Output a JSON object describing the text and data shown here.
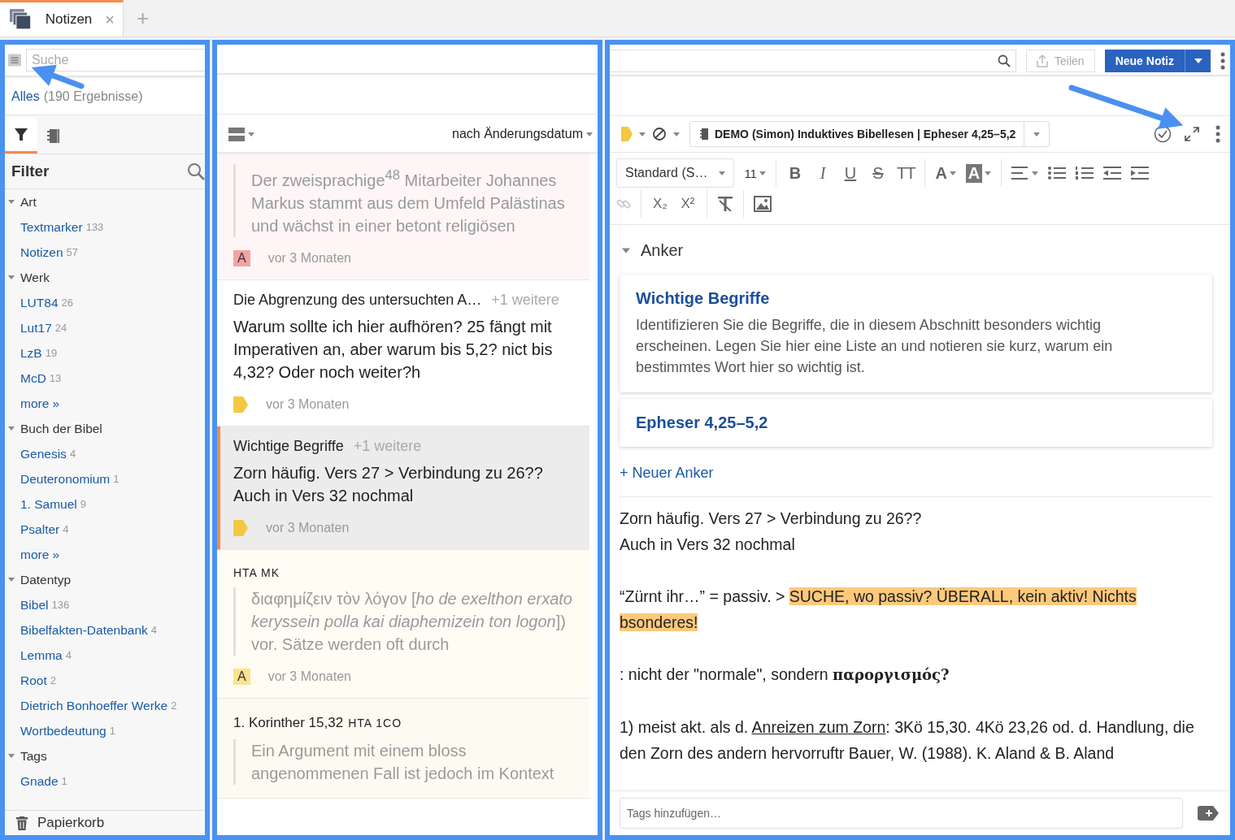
{
  "tab": {
    "title": "Notizen",
    "selected": true,
    "close": "×",
    "add": "+"
  },
  "sidebar": {
    "search": {
      "placeholder": "Suche"
    },
    "scope": {
      "label": "Alles",
      "count": "(190 Ergebnisse)"
    },
    "tabs": [
      {
        "kind": "filter",
        "selected": true
      },
      {
        "kind": "notebooks",
        "selected": false
      }
    ],
    "filter_title": "Filter",
    "groups": [
      {
        "label": "Art",
        "expanded": true,
        "items": [
          {
            "label": "Textmarker",
            "count": "133"
          },
          {
            "label": "Notizen",
            "count": "57"
          }
        ]
      },
      {
        "label": "Werk",
        "expanded": true,
        "items": [
          {
            "label": "LUT84",
            "count": "26"
          },
          {
            "label": "Lut17",
            "count": "24"
          },
          {
            "label": "LzB",
            "count": "19"
          },
          {
            "label": "McD",
            "count": "13"
          },
          {
            "label": "more »"
          }
        ]
      },
      {
        "label": "Buch der Bibel",
        "expanded": true,
        "items": [
          {
            "label": "Genesis",
            "count": "4"
          },
          {
            "label": "Deuteronomium",
            "count": "1"
          },
          {
            "label": "1. Samuel",
            "count": "9"
          },
          {
            "label": "Psalter",
            "count": "4"
          },
          {
            "label": "more »"
          }
        ]
      },
      {
        "label": "Datentyp",
        "expanded": true,
        "items": [
          {
            "label": "Bibel",
            "count": "136"
          },
          {
            "label": "Bibelfakten-Datenbank",
            "count": "4"
          },
          {
            "label": "Lemma",
            "count": "4"
          },
          {
            "label": "Root",
            "count": "2"
          },
          {
            "label": "Dietrich Bonhoeffer Werke",
            "count": "2"
          },
          {
            "label": "Wortbedeutung",
            "count": "1"
          }
        ]
      },
      {
        "label": "Tags",
        "expanded": true,
        "items": [
          {
            "label": "Gnade",
            "count": "1"
          }
        ]
      }
    ],
    "trash": "Papierkorb"
  },
  "list": {
    "sort": "nach Änderungsdatum",
    "cards": [
      {
        "kind": "highlight",
        "selected": false,
        "color": "#f4a3a3",
        "quote": "Der zweisprachige$^{48}$ Mitarbeiter Johannes Markus stammt aus dem Umfeld Palästinas und wächst in einer betont religiösen",
        "badge": "A",
        "time": "vor 3 Monaten"
      },
      {
        "kind": "note",
        "selected": false,
        "title": "Die Abgrenzung des untersuchten A…",
        "more": "+1 weitere",
        "body": "Warum sollte ich hier aufhören? 25 fängt mit Imperativen an, aber warum bis 5,2? nict bis 4,32? Oder noch weiter?h",
        "time": "vor 3 Monaten"
      },
      {
        "kind": "note",
        "selected": true,
        "title": "Wichtige Begriffe",
        "more": "+1 weitere",
        "body": "Zorn häufig. Vers 27 > Verbindung zu 26??\nAuch in Vers 32 nochmal",
        "time": "vor 3 Monaten"
      },
      {
        "kind": "highlight",
        "selected": false,
        "color": "#fbe38e",
        "heading": "HTA MK",
        "quote": "διαφημίζειν τὸν λόγον [*ho de exelthon erxato keryssein polla kai diaphemizein ton logon*]) vor. Sätze werden oft durch",
        "badge": "A",
        "time": "vor 3 Monaten"
      },
      {
        "kind": "highlight",
        "selected": false,
        "heading": "1. Korinther 15,32",
        "code": "HTA 1CO",
        "quote": "Ein Argument mit einem bloss angenommenen Fall ist jedoch im Kontext"
      }
    ]
  },
  "editor": {
    "share": "Teilen",
    "new_note": "Neue Notiz",
    "notebook": "DEMO (Simon) Induktives Bibellesen | Epheser 4,25–5,2",
    "toolbar": {
      "style": "Standard (S…",
      "size": "11",
      "text_buttons": [
        {
          "label": "B",
          "kind": "bold"
        },
        {
          "label": "I",
          "kind": "italic"
        },
        {
          "label": "U",
          "kind": "underline"
        },
        {
          "label": "S",
          "kind": "strike"
        },
        {
          "label": "TT",
          "kind": "caps"
        }
      ],
      "color_buttons": [
        {
          "label": "A",
          "kind": "text-color"
        },
        {
          "label": "A",
          "kind": "highlight"
        }
      ],
      "script_buttons": [
        "X₂",
        "X²"
      ]
    },
    "anchors": {
      "title": "Anker",
      "expanded": true,
      "items": [
        {
          "title": "Wichtige Begriffe",
          "description": "Identifizieren Sie die Begriffe, die in diesem Abschnitt besonders wichtig erscheinen. Legen Sie hier eine Liste an und notieren sie kurz, warum ein bestimmtes Wort hier so wichtig ist."
        },
        {
          "title": "Epheser 4,25–5,2"
        }
      ],
      "add": "+ Neuer Anker"
    },
    "paragraphs": [
      [
        {
          "text": "Zorn häufig. Vers 27 > Verbindung zu 26??\nAuch in Vers 32 nochmal"
        }
      ],
      [
        {
          "text": "“Zürnt ihr…” = passiv.  > "
        },
        {
          "text": "SUCHE, wo passiv? ÜBERALL, kein aktiv! Nichts bsonderes!",
          "kind": "highlight"
        }
      ],
      [
        {
          "text": ": nicht der \"normale\", sondern "
        },
        {
          "text": "παροργισμός?",
          "kind": "bold"
        }
      ],
      [
        {
          "text": "1) meist akt. als d. "
        },
        {
          "text": "Anreizen zum Zorn",
          "kind": "underline"
        },
        {
          "text": ": 3Kö 15,30. 4Kö 23,26 od. d. Handlung, die den Zorn des andern hervorruftr Bauer, W. (1988). K. Aland & B. Aland"
        }
      ]
    ],
    "tags": {
      "placeholder": "Tags hinzufügen…"
    }
  }
}
